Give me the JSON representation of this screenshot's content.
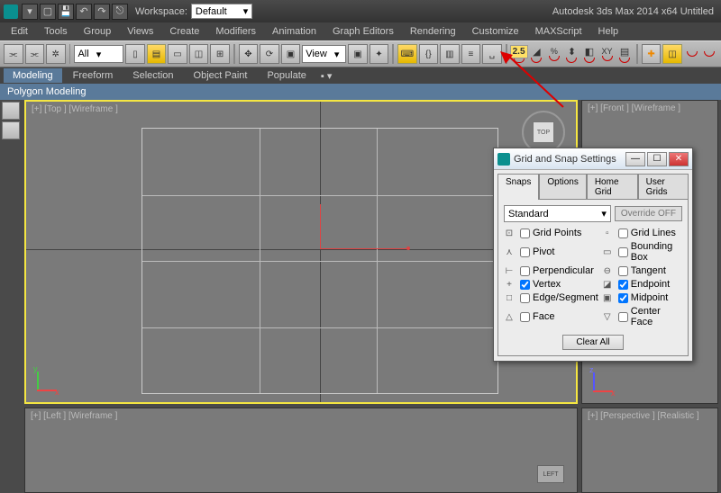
{
  "titlebar": {
    "workspace_label": "Workspace:",
    "workspace_value": "Default",
    "app_title": "Autodesk 3ds Max 2014 x64   Untitled"
  },
  "menu": [
    "Edit",
    "Tools",
    "Group",
    "Views",
    "Create",
    "Modifiers",
    "Animation",
    "Graph Editors",
    "Rendering",
    "Customize",
    "MAXScript",
    "Help"
  ],
  "toolbar": {
    "dd1": "All",
    "dd_view": "View",
    "snap_toggle": "2.5",
    "pct": "%",
    "xy": "XY"
  },
  "ribbon": {
    "tabs": [
      "Modeling",
      "Freeform",
      "Selection",
      "Object Paint",
      "Populate"
    ],
    "sub": "Polygon Modeling"
  },
  "viewports": {
    "tl": "[+] [Top ] [Wireframe ]",
    "tr": "[+] [Front ] [Wireframe ]",
    "bl": "[+] [Left ] [Wireframe ]",
    "br": "[+] [Perspective ] [Realistic ]",
    "cube": "TOP",
    "left_btn": "LEFT",
    "axes": {
      "x": "x",
      "y": "y",
      "z": "z"
    }
  },
  "dialog": {
    "title": "Grid and Snap Settings",
    "tabs": [
      "Snaps",
      "Options",
      "Home Grid",
      "User Grids"
    ],
    "standard": "Standard",
    "override": "Override OFF",
    "clear": "Clear All",
    "snaps": [
      {
        "icon": "⊡",
        "label": "Grid Points",
        "checked": false
      },
      {
        "icon": "▫",
        "label": "Grid Lines",
        "checked": false
      },
      {
        "icon": "⋏",
        "label": "Pivot",
        "checked": false
      },
      {
        "icon": "▭",
        "label": "Bounding Box",
        "checked": false
      },
      {
        "icon": "⊢",
        "label": "Perpendicular",
        "checked": false
      },
      {
        "icon": "⊖",
        "label": "Tangent",
        "checked": false
      },
      {
        "icon": "+",
        "label": "Vertex",
        "checked": true
      },
      {
        "icon": "◪",
        "label": "Endpoint",
        "checked": true
      },
      {
        "icon": "□",
        "label": "Edge/Segment",
        "checked": false
      },
      {
        "icon": "▣",
        "label": "Midpoint",
        "checked": true
      },
      {
        "icon": "△",
        "label": "Face",
        "checked": false
      },
      {
        "icon": "▽",
        "label": "Center Face",
        "checked": false
      }
    ]
  }
}
